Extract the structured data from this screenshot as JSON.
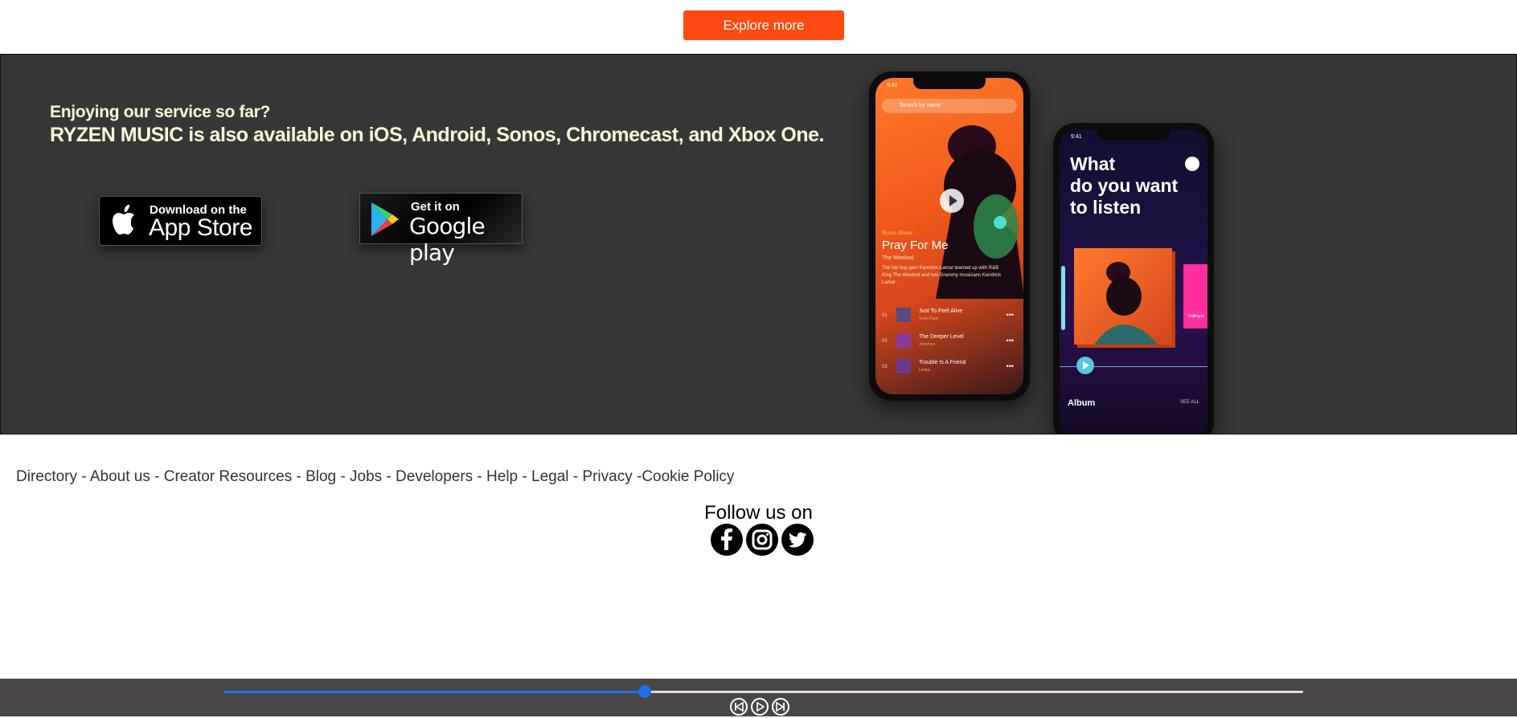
{
  "explore": {
    "label": "Explore more"
  },
  "banner": {
    "subtitle": "Enjoying our service so far?",
    "title": "RYZEN MUSIC is also available on iOS, Android, Sonos, Chromecast, and Xbox One.",
    "appstore": {
      "small": "Download on the",
      "big": "App Store",
      "icon": "apple-icon"
    },
    "googleplay": {
      "small": "Get it on",
      "big": "Google play",
      "icon": "google-play-icon"
    }
  },
  "phone1": {
    "time": "9:41",
    "search_placeholder": "Search by name",
    "label": "Ryzen Music",
    "song_title": "Pray For Me",
    "song_artist": "The Weeknd",
    "song_desc": "The hip hop gem Kendrick Lamar teamed up with R&B King The Weeknd and two Grammy musicians Kendrick Lamar",
    "tracks": [
      {
        "num": "01",
        "name": "Just To Feel Alive",
        "artist": "Sean Pauli"
      },
      {
        "num": "02",
        "name": "The Deeper Level",
        "artist": "Jobsmon"
      },
      {
        "num": "03",
        "name": "Trouble Is A Friend",
        "artist": "Lenka"
      }
    ]
  },
  "phone2": {
    "time": "9:41",
    "headline_line1": "What",
    "headline_line2": "do you want",
    "headline_line3": "to listen",
    "side_album": "Falling In",
    "album_label": "Album",
    "see_all": "SEE ALL"
  },
  "footer": {
    "links": [
      "Directory",
      "About us",
      "Creator Resources",
      "Blog",
      "Jobs",
      "Developers",
      "Help",
      "Legal",
      "Privacy",
      "Cookie Policy"
    ],
    "separator": " - ",
    "follow": "Follow us on",
    "social": [
      "facebook-icon",
      "instagram-icon",
      "twitter-icon"
    ]
  },
  "player": {
    "progress": 0.39,
    "controls": [
      "previous-icon",
      "play-icon",
      "next-icon"
    ]
  }
}
